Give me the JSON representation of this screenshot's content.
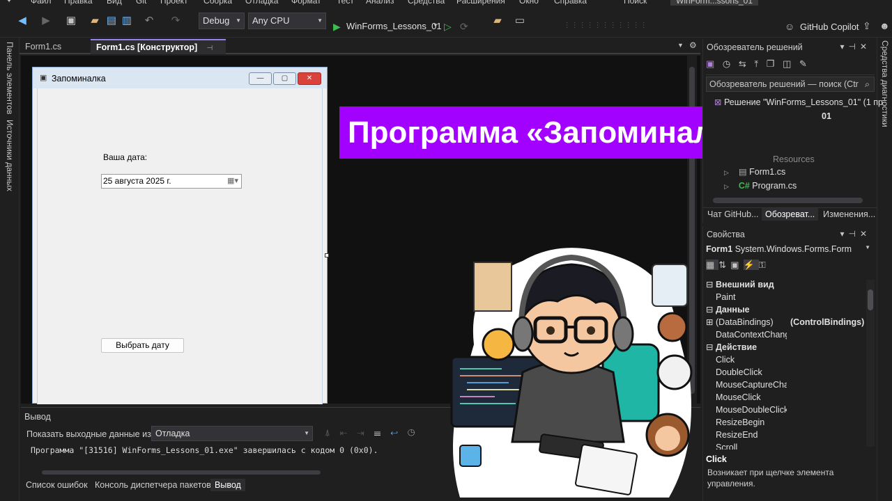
{
  "menu": {
    "items": [
      "Файл",
      "Правка",
      "Вид",
      "Git",
      "Проект",
      "Сборка",
      "Отладка",
      "Формат",
      "Тест",
      "Анализ",
      "Средства",
      "Расширения",
      "Окно",
      "Справка"
    ],
    "search": "Поиск",
    "window_title": "WinForm...ssons_01"
  },
  "toolbar": {
    "config": "Debug",
    "platform": "Any CPU",
    "run_target": "WinForms_Lessons_01",
    "copilot": "GitHub Copilot"
  },
  "left_strip": {
    "toolbox": "Панель элементов",
    "datasources": "Источники данных"
  },
  "right_strip": {
    "diagnostics": "Средства диагностики"
  },
  "tabs": {
    "form_cs": "Form1.cs",
    "form_designer": "Form1.cs [Конструктор]"
  },
  "form": {
    "title": "Запоминалка",
    "date_label": "Ваша дата:",
    "date_value": "25  августа  2025 г.",
    "button_label": "Выбрать дату"
  },
  "banner": {
    "text": "Программа «Запоминалка»"
  },
  "solution_explorer": {
    "title": "Обозреватель решений",
    "search_placeholder": "Обозреватель решений — поиск (Ctr",
    "solution": "Решение \"WinForms_Lessons_01\"  (1 пр",
    "project_suffix": "01",
    "resources": "Resources",
    "items": [
      "Form1.cs",
      "Program.cs"
    ],
    "tabs": [
      "Чат GitHub...",
      "Обозреват...",
      "Изменения..."
    ]
  },
  "properties": {
    "title": "Свойства",
    "object_name": "Form1",
    "object_type": "System.Windows.Forms.Form",
    "rows": [
      {
        "name": "Внешний вид",
        "value": "",
        "category": true
      },
      {
        "name": "Paint",
        "value": "",
        "category": false
      },
      {
        "name": "Данные",
        "value": "",
        "category": true
      },
      {
        "name": "(DataBindings)",
        "value": "(ControlBindings)",
        "category": false
      },
      {
        "name": "DataContextChang",
        "value": "",
        "category": false
      },
      {
        "name": "Действие",
        "value": "",
        "category": true
      },
      {
        "name": "Click",
        "value": "",
        "category": false
      },
      {
        "name": "DoubleClick",
        "value": "",
        "category": false
      },
      {
        "name": "MouseCaptureChan",
        "value": "",
        "category": false
      },
      {
        "name": "MouseClick",
        "value": "",
        "category": false
      },
      {
        "name": "MouseDoubleClick",
        "value": "",
        "category": false
      },
      {
        "name": "ResizeBegin",
        "value": "",
        "category": false
      },
      {
        "name": "ResizeEnd",
        "value": "",
        "category": false
      },
      {
        "name": "Scroll",
        "value": "",
        "category": false
      }
    ],
    "desc_title": "Click",
    "desc_text": "Возникает при щелчке элемента управления."
  },
  "output": {
    "title": "Вывод",
    "show_label": "Показать выходные данные из:",
    "source": "Отладка",
    "line": "Программа \"[31516] WinForms_Lessons_01.exe\" завершилась с кодом 0 (0x0)."
  },
  "bottom_tabs": [
    "Список ошибок",
    "Консоль диспетчера пакетов",
    "Вывод"
  ],
  "colors": {
    "banner": "#a200ff",
    "accent": "#9184ee"
  }
}
